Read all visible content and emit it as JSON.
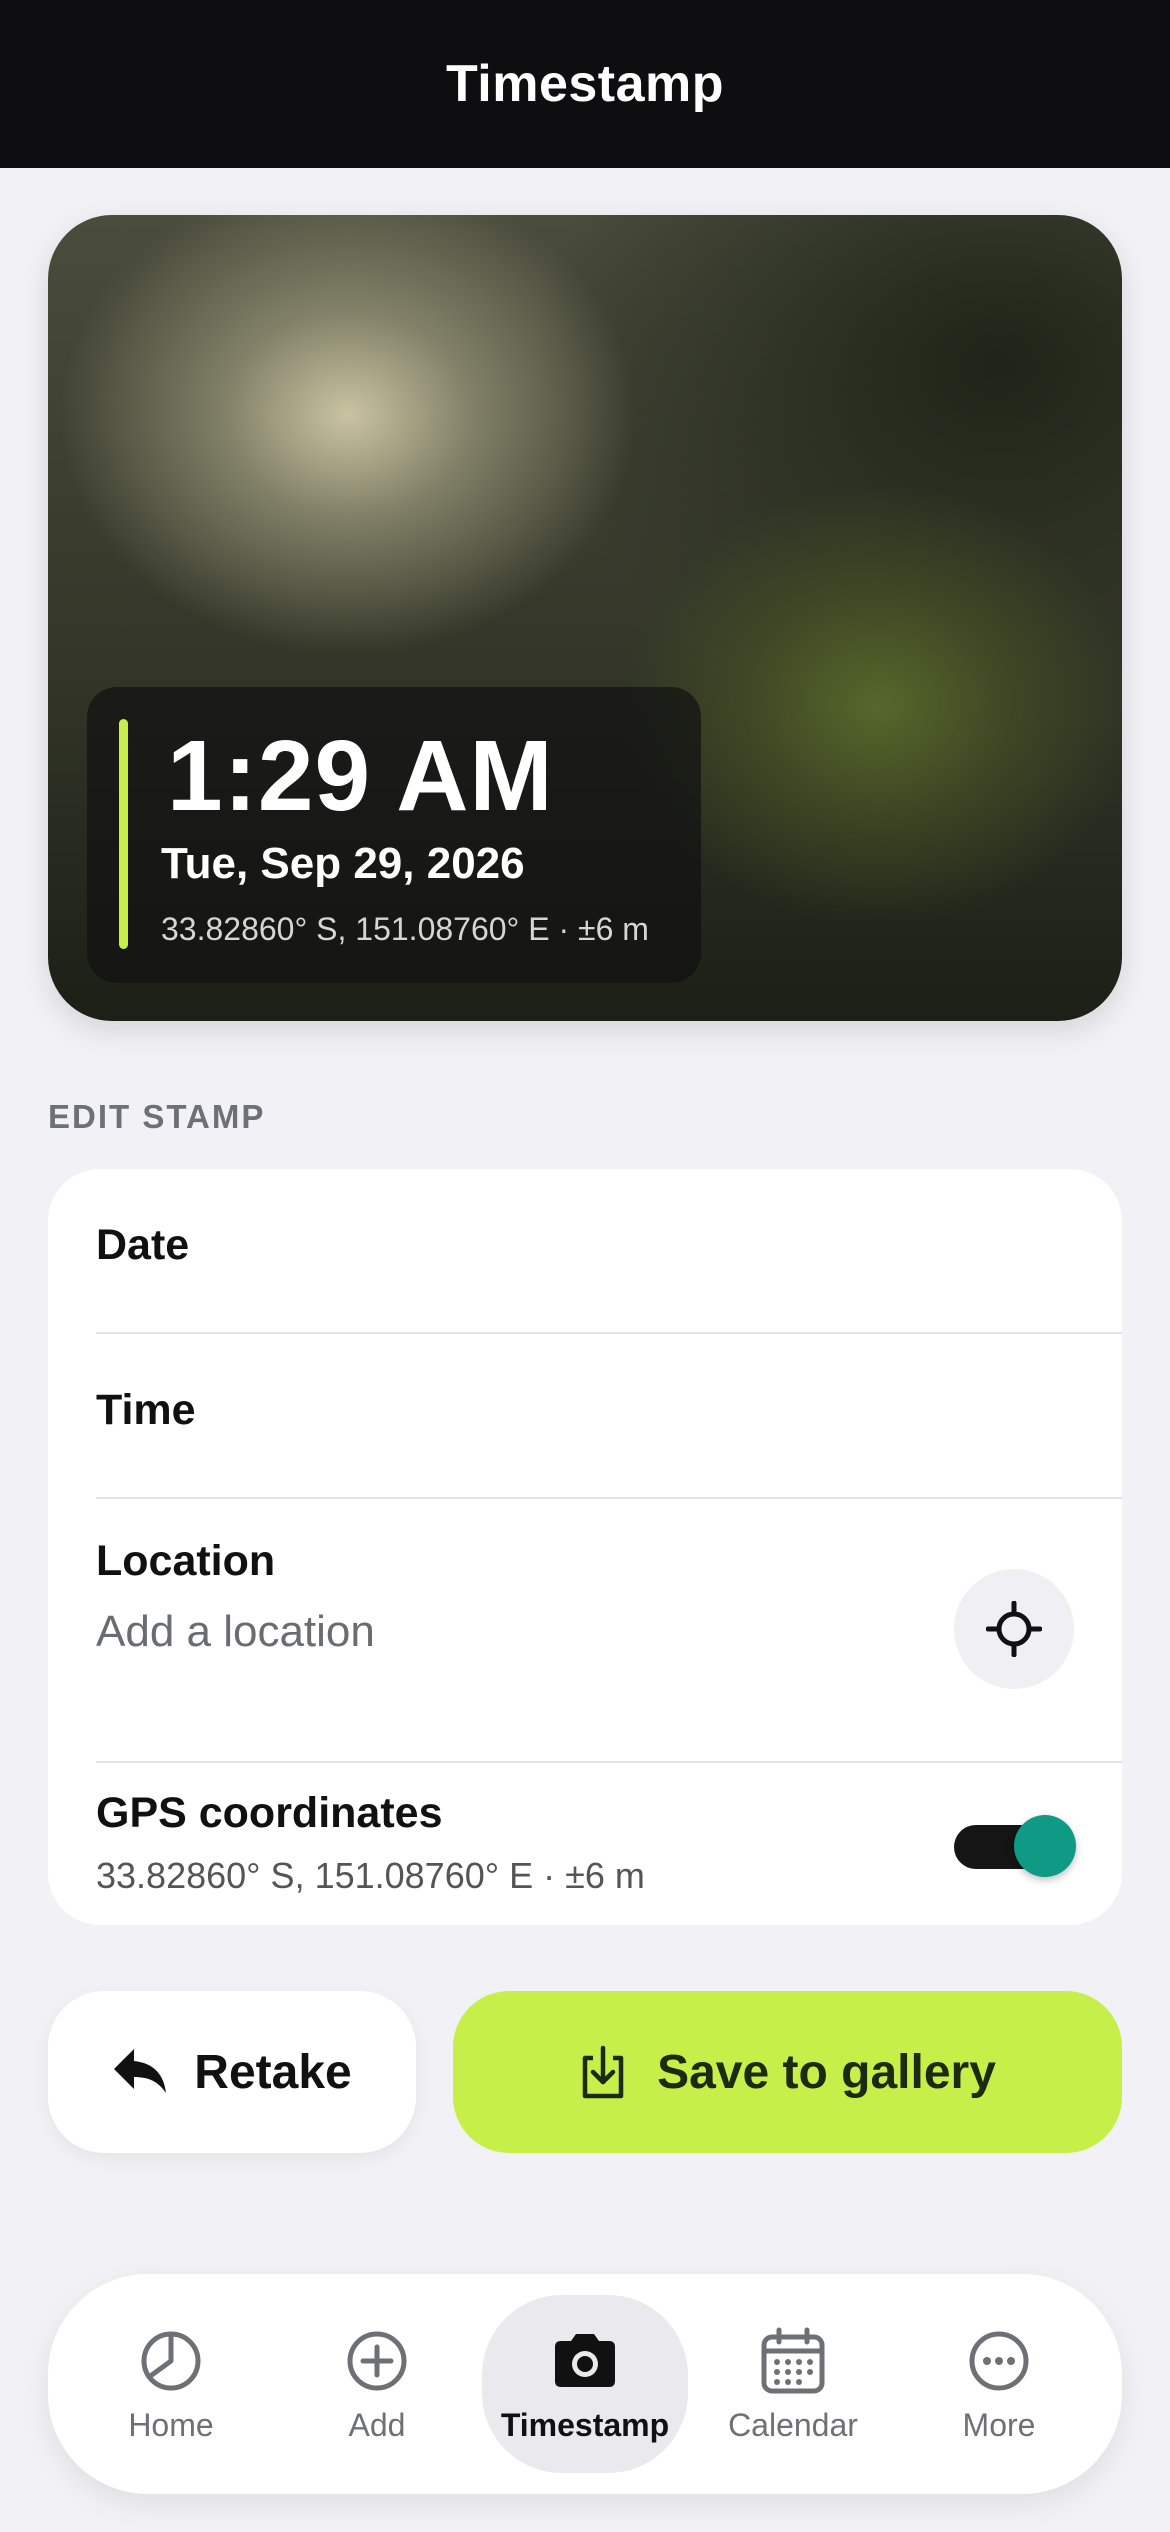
{
  "header": {
    "title": "Timestamp"
  },
  "preview": {
    "time": "1:29 AM",
    "date": "Tue, Sep 29, 2026",
    "coords": "33.82860° S, 151.08760° E · ±6 m"
  },
  "edit": {
    "section_label": "EDIT STAMP",
    "date_label": "Date",
    "time_label": "Time",
    "location_label": "Location",
    "location_placeholder": "Add a location",
    "gps_label": "GPS coordinates",
    "gps_value": "33.82860° S, 151.08760° E · ±6 m",
    "gps_enabled": true
  },
  "actions": {
    "retake_label": "Retake",
    "save_label": "Save to gallery"
  },
  "tabs": [
    {
      "label": "Home",
      "icon": "pie-chart-icon",
      "active": false
    },
    {
      "label": "Add",
      "icon": "plus-circle-icon",
      "active": false
    },
    {
      "label": "Timestamp",
      "icon": "camera-icon",
      "active": true
    },
    {
      "label": "Calendar",
      "icon": "calendar-icon",
      "active": false
    },
    {
      "label": "More",
      "icon": "more-icon",
      "active": false
    }
  ],
  "colors": {
    "accent": "#c6ef4a",
    "toggle_on": "#0f9a86",
    "header_bg": "#0e0e10"
  }
}
